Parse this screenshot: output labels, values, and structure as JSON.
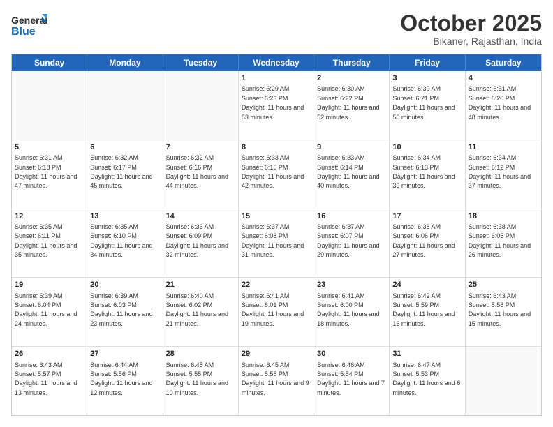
{
  "header": {
    "logo_line1": "General",
    "logo_line2": "Blue",
    "month_title": "October 2025",
    "location": "Bikaner, Rajasthan, India"
  },
  "days_of_week": [
    "Sunday",
    "Monday",
    "Tuesday",
    "Wednesday",
    "Thursday",
    "Friday",
    "Saturday"
  ],
  "weeks": [
    [
      {
        "day": "",
        "text": ""
      },
      {
        "day": "",
        "text": ""
      },
      {
        "day": "",
        "text": ""
      },
      {
        "day": "1",
        "text": "Sunrise: 6:29 AM\nSunset: 6:23 PM\nDaylight: 11 hours and 53 minutes."
      },
      {
        "day": "2",
        "text": "Sunrise: 6:30 AM\nSunset: 6:22 PM\nDaylight: 11 hours and 52 minutes."
      },
      {
        "day": "3",
        "text": "Sunrise: 6:30 AM\nSunset: 6:21 PM\nDaylight: 11 hours and 50 minutes."
      },
      {
        "day": "4",
        "text": "Sunrise: 6:31 AM\nSunset: 6:20 PM\nDaylight: 11 hours and 48 minutes."
      }
    ],
    [
      {
        "day": "5",
        "text": "Sunrise: 6:31 AM\nSunset: 6:18 PM\nDaylight: 11 hours and 47 minutes."
      },
      {
        "day": "6",
        "text": "Sunrise: 6:32 AM\nSunset: 6:17 PM\nDaylight: 11 hours and 45 minutes."
      },
      {
        "day": "7",
        "text": "Sunrise: 6:32 AM\nSunset: 6:16 PM\nDaylight: 11 hours and 44 minutes."
      },
      {
        "day": "8",
        "text": "Sunrise: 6:33 AM\nSunset: 6:15 PM\nDaylight: 11 hours and 42 minutes."
      },
      {
        "day": "9",
        "text": "Sunrise: 6:33 AM\nSunset: 6:14 PM\nDaylight: 11 hours and 40 minutes."
      },
      {
        "day": "10",
        "text": "Sunrise: 6:34 AM\nSunset: 6:13 PM\nDaylight: 11 hours and 39 minutes."
      },
      {
        "day": "11",
        "text": "Sunrise: 6:34 AM\nSunset: 6:12 PM\nDaylight: 11 hours and 37 minutes."
      }
    ],
    [
      {
        "day": "12",
        "text": "Sunrise: 6:35 AM\nSunset: 6:11 PM\nDaylight: 11 hours and 35 minutes."
      },
      {
        "day": "13",
        "text": "Sunrise: 6:35 AM\nSunset: 6:10 PM\nDaylight: 11 hours and 34 minutes."
      },
      {
        "day": "14",
        "text": "Sunrise: 6:36 AM\nSunset: 6:09 PM\nDaylight: 11 hours and 32 minutes."
      },
      {
        "day": "15",
        "text": "Sunrise: 6:37 AM\nSunset: 6:08 PM\nDaylight: 11 hours and 31 minutes."
      },
      {
        "day": "16",
        "text": "Sunrise: 6:37 AM\nSunset: 6:07 PM\nDaylight: 11 hours and 29 minutes."
      },
      {
        "day": "17",
        "text": "Sunrise: 6:38 AM\nSunset: 6:06 PM\nDaylight: 11 hours and 27 minutes."
      },
      {
        "day": "18",
        "text": "Sunrise: 6:38 AM\nSunset: 6:05 PM\nDaylight: 11 hours and 26 minutes."
      }
    ],
    [
      {
        "day": "19",
        "text": "Sunrise: 6:39 AM\nSunset: 6:04 PM\nDaylight: 11 hours and 24 minutes."
      },
      {
        "day": "20",
        "text": "Sunrise: 6:39 AM\nSunset: 6:03 PM\nDaylight: 11 hours and 23 minutes."
      },
      {
        "day": "21",
        "text": "Sunrise: 6:40 AM\nSunset: 6:02 PM\nDaylight: 11 hours and 21 minutes."
      },
      {
        "day": "22",
        "text": "Sunrise: 6:41 AM\nSunset: 6:01 PM\nDaylight: 11 hours and 19 minutes."
      },
      {
        "day": "23",
        "text": "Sunrise: 6:41 AM\nSunset: 6:00 PM\nDaylight: 11 hours and 18 minutes."
      },
      {
        "day": "24",
        "text": "Sunrise: 6:42 AM\nSunset: 5:59 PM\nDaylight: 11 hours and 16 minutes."
      },
      {
        "day": "25",
        "text": "Sunrise: 6:43 AM\nSunset: 5:58 PM\nDaylight: 11 hours and 15 minutes."
      }
    ],
    [
      {
        "day": "26",
        "text": "Sunrise: 6:43 AM\nSunset: 5:57 PM\nDaylight: 11 hours and 13 minutes."
      },
      {
        "day": "27",
        "text": "Sunrise: 6:44 AM\nSunset: 5:56 PM\nDaylight: 11 hours and 12 minutes."
      },
      {
        "day": "28",
        "text": "Sunrise: 6:45 AM\nSunset: 5:55 PM\nDaylight: 11 hours and 10 minutes."
      },
      {
        "day": "29",
        "text": "Sunrise: 6:45 AM\nSunset: 5:55 PM\nDaylight: 11 hours and 9 minutes."
      },
      {
        "day": "30",
        "text": "Sunrise: 6:46 AM\nSunset: 5:54 PM\nDaylight: 11 hours and 7 minutes."
      },
      {
        "day": "31",
        "text": "Sunrise: 6:47 AM\nSunset: 5:53 PM\nDaylight: 11 hours and 6 minutes."
      },
      {
        "day": "",
        "text": ""
      }
    ]
  ]
}
